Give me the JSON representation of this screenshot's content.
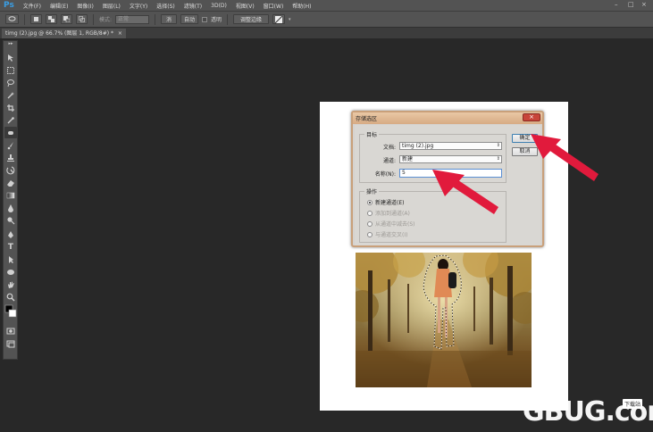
{
  "app": {
    "logo": "Ps",
    "menu": [
      "文件(F)",
      "编辑(E)",
      "图像(I)",
      "图层(L)",
      "文字(Y)",
      "选择(S)",
      "滤镜(T)",
      "3D(D)",
      "视图(V)",
      "窗口(W)",
      "帮助(H)"
    ],
    "window_controls": [
      "–",
      "□",
      "×"
    ]
  },
  "options_bar": {
    "feather_label": "模式:",
    "mode_value": "正常",
    "align_label": "调整边缘",
    "btn_a": "消",
    "btn_b": "自动",
    "checkbox_label": "透明",
    "refine_button": "调整边缘"
  },
  "document_tab": {
    "title": "timg (2).jpg @ 66.7% (图层 1, RGB/8#) *",
    "close": "×"
  },
  "dialog": {
    "title": "存储选区",
    "close": "×",
    "target_group": "目标",
    "doc_label": "文档:",
    "doc_value": "timg (2).jpg",
    "channel_label": "通道:",
    "channel_value": "新建",
    "name_label": "名称(N):",
    "name_value": "5",
    "operation_group": "操作",
    "ops": [
      {
        "label": "新建通道(E)",
        "selected": true,
        "enabled": true
      },
      {
        "label": "添加到通道(A)",
        "selected": false,
        "enabled": false
      },
      {
        "label": "从通道中减去(S)",
        "selected": false,
        "enabled": false
      },
      {
        "label": "与通道交叉(I)",
        "selected": false,
        "enabled": false
      }
    ],
    "ok_button": "确定",
    "cancel_button": "取消"
  },
  "watermark": {
    "text": "GBUG.com",
    "badge": "下载站"
  },
  "colors": {
    "accent_red": "#e11a3c",
    "ps_blue": "#3a9ee4",
    "dialog_frame": "#c9a07a"
  }
}
